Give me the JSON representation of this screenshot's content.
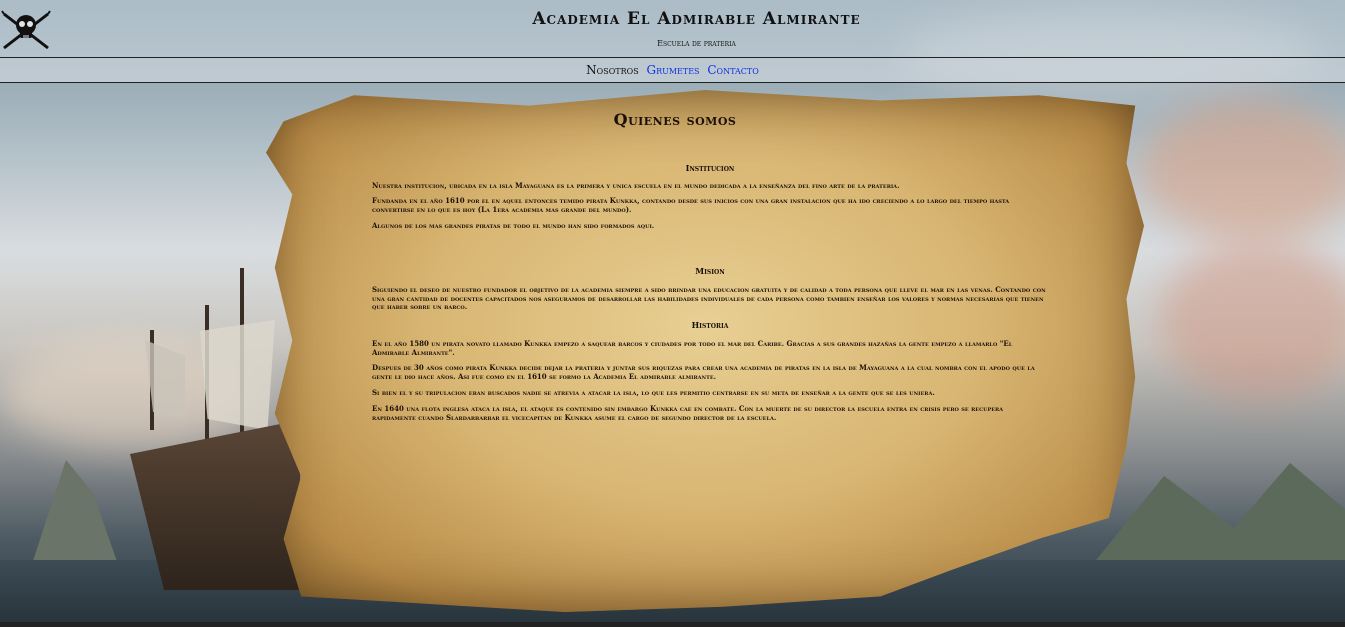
{
  "header": {
    "title": "Academia El Admirable Almirante",
    "subtitle": "Escuela de prateria"
  },
  "nav": {
    "items": [
      {
        "label": "Nosotros",
        "active": true
      },
      {
        "label": "Grumetes",
        "active": false
      },
      {
        "label": "Contacto",
        "active": false
      }
    ]
  },
  "content": {
    "title": "Quienes somos",
    "institucion": {
      "heading": "Institucion",
      "paragraphs": [
        "Nuestra institucion, ubicada en la isla Mayaguana es la primera y unica escuela en el mundo dedicada a la enseñanza del fino arte de la prateria.",
        "Fundanda en el año 1610 por el en aquel entonces temido pirata Kunkka, contando desde sus inicios con una gran instalacion que ha ido creciendo a lo largo del tiempo hasta convertirse en lo que es hoy (La 1era academia mas grande del mundo).",
        "Algunos de los mas grandes piratas de todo el mundo han sido formados aqui."
      ]
    },
    "mision": {
      "heading": "Mision",
      "paragraphs": [
        "Siguiendo el deseo de nuestro fundador el objetivo de la academia siempre a sido brindar una educacion gratuita y de calidad a toda persona que lleve el mar en las venas. Contando con una gran cantidad de docentes capacitados nos aseguramos de desarrollar las habilidades individuales de cada persona como tambien enseñar los valores y normas necesarias que tienen que haber sobre un barco."
      ]
    },
    "historia": {
      "heading": "Historia",
      "paragraphs": [
        "En el año 1580 un pirata novato llamado Kunkka empezo a saquear barcos y ciudades por todo el mar del Caribe. Gracias a sus grandes hazañas la gente empezo a llamarlo \"El Admirable Almirante\".",
        "Despues de 30 años como pirata Kunkka decide dejar la prateria y juntar sus riquezas para crear una academia de piratas en la isla de Mayaguana a la cual nombra con el apodo que la gente le dio hace años. Asi fue como en el 1610 se formo la Academia El admirable almirante.",
        "Si bien el y su tripulacion eran buscados nadie se atrevia a atacar la isla, lo que les permitio centrarse en su meta de enseñar a la gente que se les uniera.",
        "En 1640 una flota inglesa ataca la isla, el ataque es contenido sin embargo Kunkka cae en combate. Con la muerte de su director la escuela entra en crisis pero se recupera rapidamente cuando Slardarbarbar el vicecapitan de Kunkka asume el cargo de segundo director de la escuela."
      ]
    }
  },
  "icons": {
    "logo": "skull-crossed-swords-icon"
  },
  "colors": {
    "nav_link": "#1030e0",
    "parchment": "#d8b572"
  }
}
